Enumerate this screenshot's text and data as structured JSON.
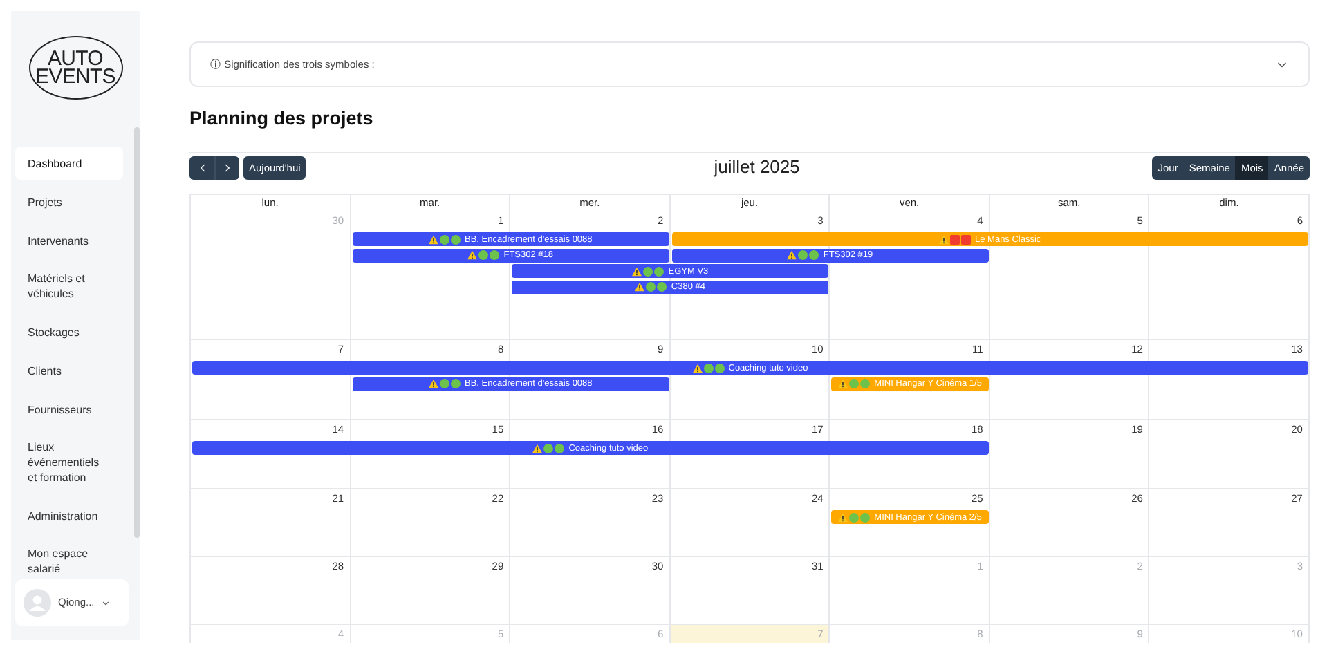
{
  "sidebar": {
    "logo": [
      "AUTO",
      "EVENTS"
    ],
    "items": [
      {
        "label": "Dashboard",
        "selected": true
      },
      {
        "label": "Projets",
        "selected": false
      },
      {
        "label": "Intervenants",
        "selected": false
      },
      {
        "label": "Matériels et véhicules",
        "selected": false
      },
      {
        "label": "Stockages",
        "selected": false
      },
      {
        "label": "Clients",
        "selected": false
      },
      {
        "label": "Fournisseurs",
        "selected": false
      },
      {
        "label": "Lieux événementiels et formation",
        "selected": false
      },
      {
        "label": "Administration",
        "selected": false
      },
      {
        "label": "Mon espace salarié",
        "selected": false
      }
    ],
    "user": {
      "name": "Qiong..."
    }
  },
  "legend": {
    "title": "ⓘ Signification des trois symboles :",
    "expanded": false
  },
  "page_title": "Planning des projets",
  "calendar": {
    "today_button": "Aujourd'hui",
    "title": "juillet 2025",
    "views": [
      {
        "label": "Jour",
        "selected": false
      },
      {
        "label": "Semaine",
        "selected": false
      },
      {
        "label": "Mois",
        "selected": true
      },
      {
        "label": "Année",
        "selected": false
      }
    ],
    "weekdays": [
      "lun.",
      "mar.",
      "mer.",
      "jeu.",
      "ven.",
      "sam.",
      "dim."
    ],
    "weeks": [
      {
        "days": [
          {
            "label": "30",
            "outside": true,
            "today": false
          },
          {
            "label": "1",
            "outside": false,
            "today": false
          },
          {
            "label": "2",
            "outside": false,
            "today": false
          },
          {
            "label": "3",
            "outside": false,
            "today": false
          },
          {
            "label": "4",
            "outside": false,
            "today": false
          },
          {
            "label": "5",
            "outside": false,
            "today": false
          },
          {
            "label": "6",
            "outside": false,
            "today": false
          }
        ],
        "events": [
          {
            "title": "BB. Encadrement d'essais 0088",
            "covers": [
              false,
              true,
              true,
              false,
              false,
              false,
              false
            ],
            "color": "#3d4ef5",
            "symbols": [
              {
                "kind": "warning"
              },
              {
                "kind": "green"
              },
              {
                "kind": "green"
              }
            ]
          },
          {
            "title": "Le Mans Classic",
            "covers": [
              false,
              false,
              false,
              true,
              true,
              true,
              true
            ],
            "color": "#ffa800",
            "symbols": [
              {
                "kind": "warning"
              },
              {
                "kind": "red"
              },
              {
                "kind": "red"
              }
            ]
          },
          {
            "title": "FTS302 #18",
            "covers": [
              false,
              true,
              true,
              false,
              false,
              false,
              false
            ],
            "color": "#3d4ef5",
            "symbols": [
              {
                "kind": "warning"
              },
              {
                "kind": "green"
              },
              {
                "kind": "green"
              }
            ]
          },
          {
            "title": "FTS302 #19",
            "covers": [
              false,
              false,
              false,
              true,
              true,
              false,
              false
            ],
            "color": "#3d4ef5",
            "symbols": [
              {
                "kind": "warning"
              },
              {
                "kind": "green"
              },
              {
                "kind": "green"
              }
            ]
          },
          {
            "title": "EGYM V3",
            "covers": [
              false,
              false,
              true,
              true,
              false,
              false,
              false
            ],
            "color": "#3d4ef5",
            "symbols": [
              {
                "kind": "warning"
              },
              {
                "kind": "green"
              },
              {
                "kind": "green"
              }
            ]
          },
          {
            "title": "C380 #4",
            "covers": [
              false,
              false,
              true,
              true,
              false,
              false,
              false
            ],
            "color": "#3d4ef5",
            "symbols": [
              {
                "kind": "warning"
              },
              {
                "kind": "green"
              },
              {
                "kind": "green"
              }
            ]
          }
        ]
      },
      {
        "days": [
          {
            "label": "7",
            "outside": false,
            "today": false
          },
          {
            "label": "8",
            "outside": false,
            "today": false
          },
          {
            "label": "9",
            "outside": false,
            "today": false
          },
          {
            "label": "10",
            "outside": false,
            "today": false
          },
          {
            "label": "11",
            "outside": false,
            "today": false
          },
          {
            "label": "12",
            "outside": false,
            "today": false
          },
          {
            "label": "13",
            "outside": false,
            "today": false
          }
        ],
        "events": [
          {
            "title": "Coaching tuto video",
            "covers": [
              true,
              true,
              true,
              true,
              true,
              true,
              true
            ],
            "color": "#3d4ef5",
            "symbols": [
              {
                "kind": "warning"
              },
              {
                "kind": "green"
              },
              {
                "kind": "green"
              }
            ]
          },
          {
            "title": "BB. Encadrement d'essais 0088",
            "covers": [
              false,
              true,
              true,
              false,
              false,
              false,
              false
            ],
            "color": "#3d4ef5",
            "symbols": [
              {
                "kind": "warning"
              },
              {
                "kind": "green"
              },
              {
                "kind": "green"
              }
            ]
          },
          {
            "title": "MINI Hangar Y Cinéma 1/5",
            "covers": [
              false,
              false,
              false,
              false,
              true,
              false,
              false
            ],
            "color": "#ffa800",
            "symbols": [
              {
                "kind": "warning"
              },
              {
                "kind": "green"
              },
              {
                "kind": "green"
              }
            ]
          }
        ]
      },
      {
        "days": [
          {
            "label": "14",
            "outside": false,
            "today": false
          },
          {
            "label": "15",
            "outside": false,
            "today": false
          },
          {
            "label": "16",
            "outside": false,
            "today": false
          },
          {
            "label": "17",
            "outside": false,
            "today": false
          },
          {
            "label": "18",
            "outside": false,
            "today": false
          },
          {
            "label": "19",
            "outside": false,
            "today": false
          },
          {
            "label": "20",
            "outside": false,
            "today": false
          }
        ],
        "events": [
          {
            "title": "Coaching tuto video",
            "covers": [
              true,
              true,
              true,
              true,
              true,
              false,
              false
            ],
            "color": "#3d4ef5",
            "symbols": [
              {
                "kind": "warning"
              },
              {
                "kind": "green"
              },
              {
                "kind": "green"
              }
            ]
          }
        ]
      },
      {
        "days": [
          {
            "label": "21",
            "outside": false,
            "today": false
          },
          {
            "label": "22",
            "outside": false,
            "today": false
          },
          {
            "label": "23",
            "outside": false,
            "today": false
          },
          {
            "label": "24",
            "outside": false,
            "today": false
          },
          {
            "label": "25",
            "outside": false,
            "today": false
          },
          {
            "label": "26",
            "outside": false,
            "today": false
          },
          {
            "label": "27",
            "outside": false,
            "today": false
          }
        ],
        "events": [
          {
            "title": "MINI Hangar Y Cinéma 2/5",
            "covers": [
              false,
              false,
              false,
              false,
              true,
              false,
              false
            ],
            "color": "#ffa800",
            "symbols": [
              {
                "kind": "warning"
              },
              {
                "kind": "green"
              },
              {
                "kind": "green"
              }
            ]
          }
        ]
      },
      {
        "days": [
          {
            "label": "28",
            "outside": false,
            "today": false
          },
          {
            "label": "29",
            "outside": false,
            "today": false
          },
          {
            "label": "30",
            "outside": false,
            "today": false
          },
          {
            "label": "31",
            "outside": false,
            "today": false
          },
          {
            "label": "1",
            "outside": true,
            "today": false
          },
          {
            "label": "2",
            "outside": true,
            "today": false
          },
          {
            "label": "3",
            "outside": true,
            "today": false
          }
        ]
      },
      {
        "days": [
          {
            "label": "4",
            "outside": true,
            "today": false
          },
          {
            "label": "5",
            "outside": true,
            "today": false
          },
          {
            "label": "6",
            "outside": true,
            "today": false
          },
          {
            "label": "7",
            "outside": true,
            "today": true
          },
          {
            "label": "8",
            "outside": true,
            "today": false
          },
          {
            "label": "9",
            "outside": true,
            "today": false
          },
          {
            "label": "10",
            "outside": true,
            "today": false
          }
        ]
      }
    ]
  }
}
